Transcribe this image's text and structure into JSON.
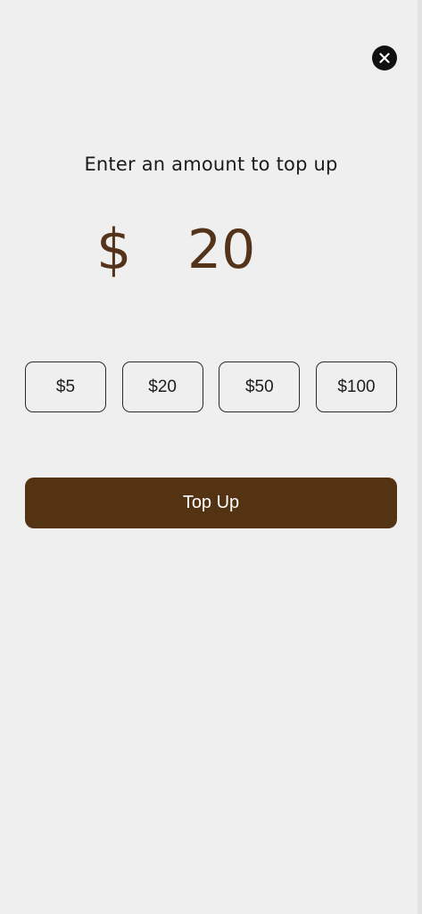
{
  "header": {
    "close_icon": "close-icon"
  },
  "prompt": "Enter an amount to top up",
  "amount": {
    "currency_symbol": "$",
    "value": "20"
  },
  "presets": [
    {
      "label": "$5"
    },
    {
      "label": "$20"
    },
    {
      "label": "$50"
    },
    {
      "label": "$100"
    }
  ],
  "action": {
    "topup_label": "Top Up"
  },
  "colors": {
    "background": "#efefef",
    "accent_brown": "#543313",
    "amount_text": "#54331a",
    "close_button": "#111111"
  }
}
